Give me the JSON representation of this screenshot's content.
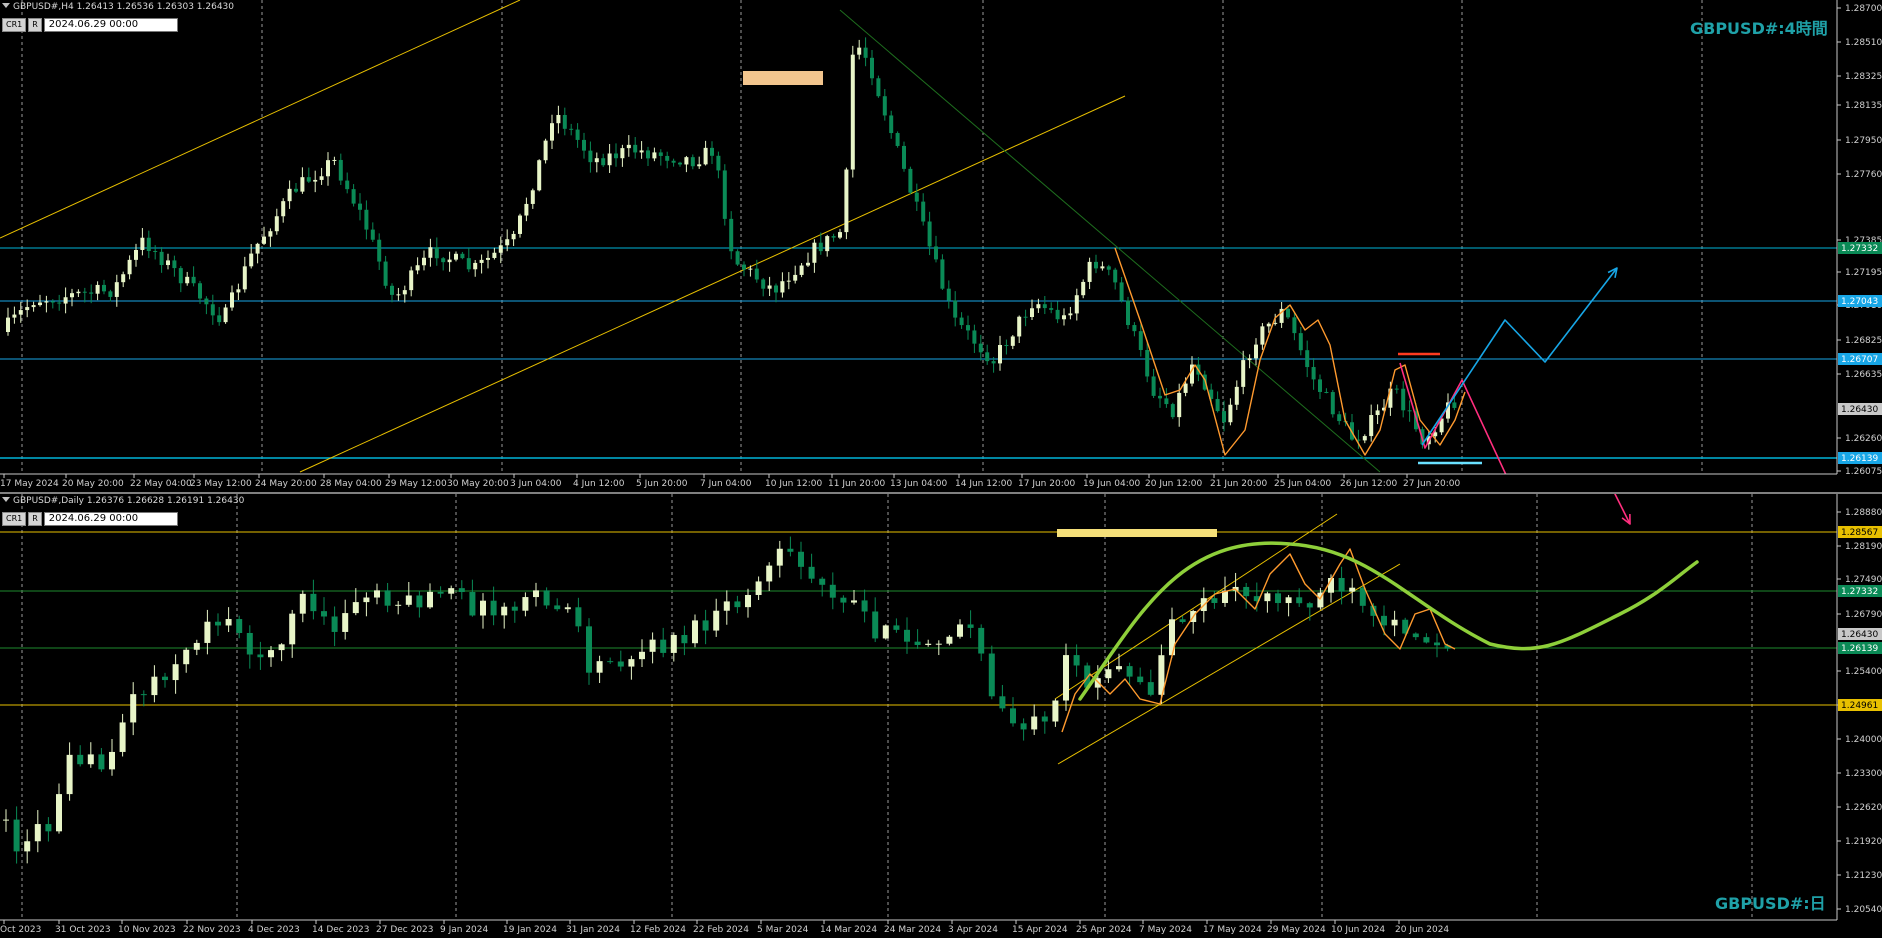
{
  "colors": {
    "bull": "#e8f5c8",
    "bear": "#0a8a56",
    "grid": "#9a9a9a",
    "cyan": "#00b4d8",
    "orange": "#ff9a2e",
    "green_curve": "#8ecf3a",
    "pink": "#ff2e7e",
    "blue_arrow": "#17a6e6",
    "yellow": "#e8c000",
    "title": "#1fa1a8"
  },
  "top": {
    "header": "GBPUSD#,H4  1.26413 1.26536 1.26303 1.26430",
    "buttons": [
      "CR1",
      "R"
    ],
    "date_value": "2024.06.29 00:00",
    "title": "GBPUSD#:4時間",
    "price_ticks": [
      "1.28700",
      "1.28510",
      "1.28325",
      "1.28135",
      "1.27950",
      "1.27760",
      "1.27385",
      "1.27195",
      "1.27010",
      "1.26825",
      "1.26635",
      "1.26260",
      "1.26075"
    ],
    "level_tags": [
      {
        "text": "1.27332",
        "bg": "#0a8a56"
      },
      {
        "text": "1.27043",
        "bg": "#17a6e6"
      },
      {
        "text": "1.26707",
        "bg": "#17a6e6"
      },
      {
        "text": "1.26430",
        "bg": "#c8c8c8"
      },
      {
        "text": "1.26139",
        "bg": "#17a6e6"
      }
    ],
    "time_ticks": [
      "17 May 2024",
      "20 May 20:00",
      "22 May 04:00",
      "23 May 12:00",
      "24 May 20:00",
      "28 May 04:00",
      "29 May 12:00",
      "30 May 20:00",
      "3 Jun 04:00",
      "4 Jun 12:00",
      "5 Jun 20:00",
      "7 Jun 04:00",
      "10 Jun 12:00",
      "11 Jun 20:00",
      "13 Jun 04:00",
      "14 Jun 12:00",
      "17 Jun 20:00",
      "19 Jun 04:00",
      "20 Jun 12:00",
      "21 Jun 20:00",
      "25 Jun 04:00",
      "26 Jun 12:00",
      "27 Jun 20:00"
    ]
  },
  "bottom": {
    "header": "GBPUSD#,Daily  1.26376 1.26628 1.26191 1.26430",
    "buttons": [
      "CR1",
      "R"
    ],
    "date_value": "2024.06.29 00:00",
    "title": "GBPUSD#:日",
    "price_ticks": [
      "1.28880",
      "1.28190",
      "1.27490",
      "1.26790",
      "1.25400",
      "1.24700",
      "1.24000",
      "1.23300",
      "1.22620",
      "1.21920",
      "1.21230",
      "1.20540"
    ],
    "level_tags": [
      {
        "text": "1.28567",
        "bg": "#e8c000"
      },
      {
        "text": "1.27332",
        "bg": "#0a8a56"
      },
      {
        "text": "1.26430",
        "bg": "#c8c8c8"
      },
      {
        "text": "1.26139",
        "bg": "#0a8a56"
      },
      {
        "text": "1.24961",
        "bg": "#e8c000"
      }
    ],
    "time_ticks": [
      "Oct 2023",
      "31 Oct 2023",
      "10 Nov 2023",
      "22 Nov 2023",
      "4 Dec 2023",
      "14 Dec 2023",
      "27 Dec 2023",
      "9 Jan 2024",
      "19 Jan 2024",
      "31 Jan 2024",
      "12 Feb 2024",
      "22 Feb 2024",
      "5 Mar 2024",
      "14 Mar 2024",
      "24 Mar 2024",
      "3 Apr 2024",
      "15 Apr 2024",
      "25 Apr 2024",
      "7 May 2024",
      "17 May 2024",
      "29 May 2024",
      "10 Jun 2024",
      "20 Jun 2024"
    ]
  }
}
